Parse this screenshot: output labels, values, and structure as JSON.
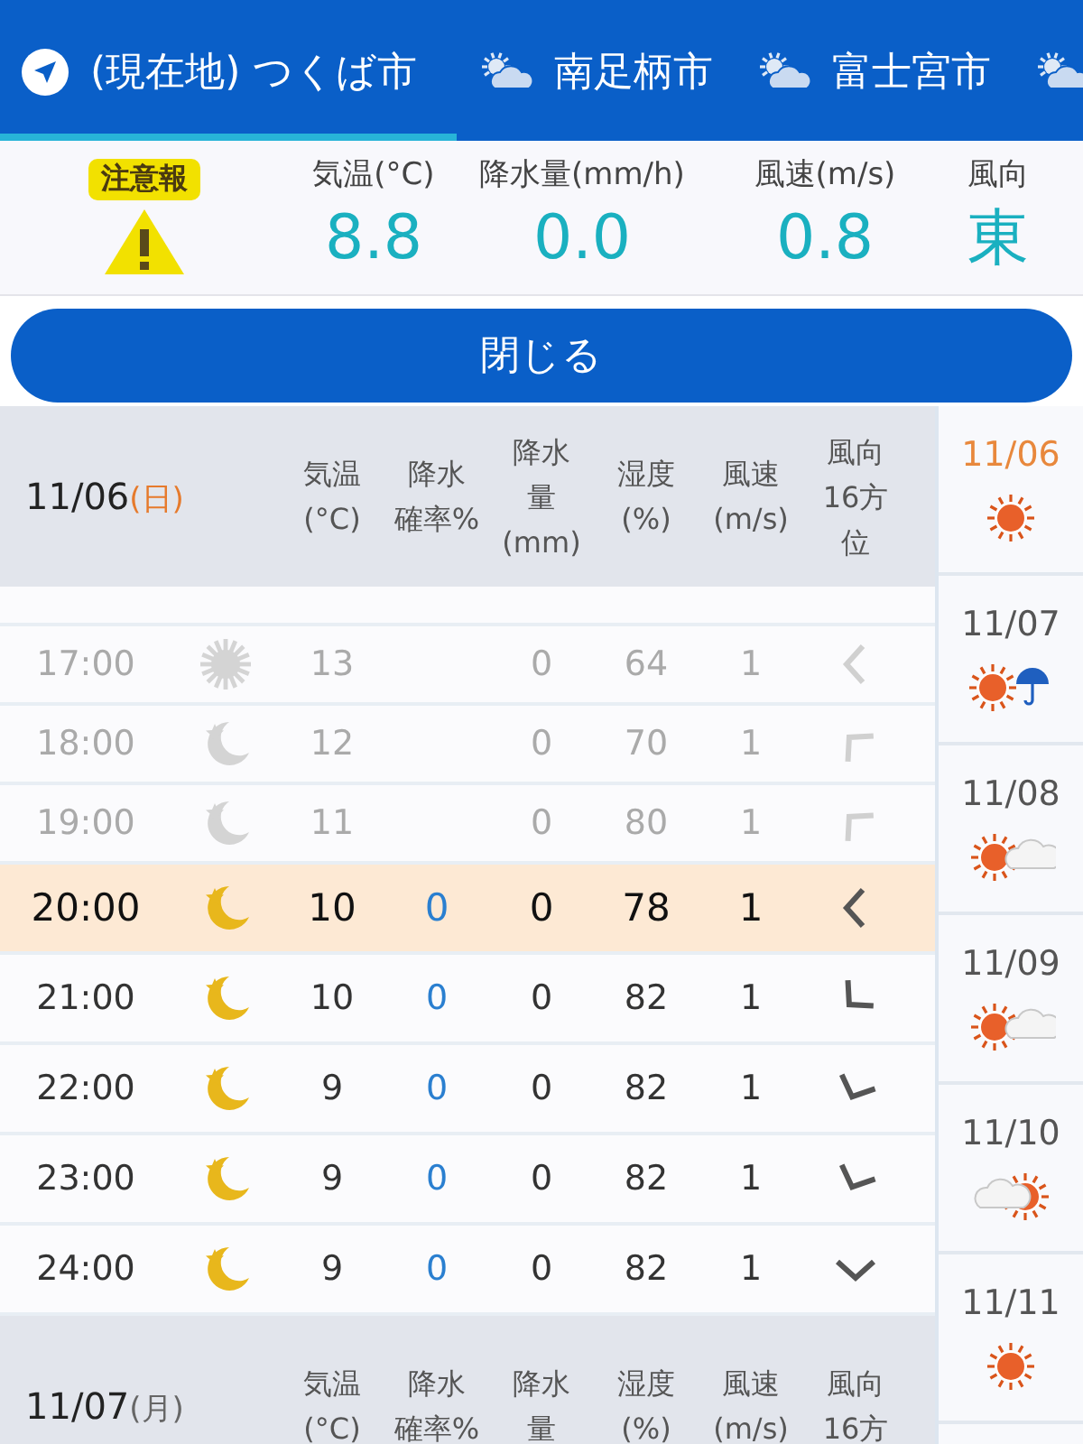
{
  "tabs": [
    {
      "label": "(現在地) つくば市",
      "kind": "location",
      "selected": true
    },
    {
      "label": "南足柄市",
      "kind": "weather",
      "selected": false
    },
    {
      "label": "富士宮市",
      "kind": "weather",
      "selected": false
    },
    {
      "kind": "weather",
      "selected": false
    }
  ],
  "current": {
    "warning": {
      "badge": "注意報"
    },
    "readings": [
      {
        "label": "気温(°C)",
        "value": "8.8"
      },
      {
        "label": "降水量(mm/h)",
        "value": "0.0"
      },
      {
        "label": "風速(m/s)",
        "value": "0.8"
      },
      {
        "label": "風向",
        "value": "東"
      }
    ]
  },
  "close_button": "閉じる",
  "days": [
    {
      "date": "11/06",
      "weekday": "(日)",
      "sunday": true,
      "columns": [
        [
          "気温",
          "(°C)"
        ],
        [
          "降水",
          "確率%"
        ],
        [
          "降水",
          "量",
          "(mm)"
        ],
        [
          "湿度",
          "(%)"
        ],
        [
          "風速",
          "(m/s)"
        ],
        [
          "風向",
          "16方",
          "位"
        ]
      ],
      "rows": [
        {
          "time": "17:00",
          "kind": "sun",
          "temp": "13",
          "rain": "0",
          "humidity": "64",
          "wind": "1",
          "direction": {
            "kind": "e"
          },
          "past": true,
          "selected": false
        },
        {
          "time": "18:00",
          "kind": "moon",
          "temp": "12",
          "rain": "0",
          "humidity": "70",
          "wind": "1",
          "direction": {
            "kind": "ne"
          },
          "past": true,
          "selected": false
        },
        {
          "time": "19:00",
          "kind": "moon",
          "temp": "11",
          "rain": "0",
          "humidity": "80",
          "wind": "1",
          "direction": {
            "kind": "ne"
          },
          "past": true,
          "selected": false
        },
        {
          "time": "20:00",
          "kind": "moon",
          "temp": "10",
          "prob": "0",
          "rain": "0",
          "humidity": "78",
          "wind": "1",
          "direction": {
            "kind": "e"
          },
          "past": false,
          "selected": true
        },
        {
          "time": "21:00",
          "kind": "moon",
          "temp": "10",
          "prob": "0",
          "rain": "0",
          "humidity": "82",
          "wind": "1",
          "direction": {
            "kind": "se"
          },
          "past": false,
          "selected": false
        },
        {
          "time": "22:00",
          "kind": "moon",
          "temp": "9",
          "prob": "0",
          "rain": "0",
          "humidity": "82",
          "wind": "1",
          "direction": {
            "kind": "sse"
          },
          "past": false,
          "selected": false
        },
        {
          "time": "23:00",
          "kind": "moon",
          "temp": "9",
          "prob": "0",
          "rain": "0",
          "humidity": "82",
          "wind": "1",
          "direction": {
            "kind": "sse"
          },
          "past": false,
          "selected": false
        },
        {
          "time": "24:00",
          "kind": "moon",
          "temp": "9",
          "prob": "0",
          "rain": "0",
          "humidity": "82",
          "wind": "1",
          "direction": {
            "kind": "s"
          },
          "past": false,
          "selected": false
        }
      ]
    },
    {
      "date": "11/07",
      "weekday": "(月)",
      "sunday": false,
      "columns": [
        [
          "気温",
          "(°C)"
        ],
        [
          "降水",
          "確率%"
        ],
        [
          "降水",
          "量"
        ],
        [
          "湿度",
          "(%)"
        ],
        [
          "風速",
          "(m/s)"
        ],
        [
          "風向",
          "16方"
        ]
      ]
    }
  ],
  "daily": [
    {
      "date": "11/06",
      "kind": "sunny",
      "selected": true
    },
    {
      "date": "11/07",
      "kind": "sunny_rain",
      "selected": false
    },
    {
      "date": "11/08",
      "kind": "sunny_cloudy",
      "selected": false
    },
    {
      "date": "11/09",
      "kind": "sunny_cloudy",
      "selected": false
    },
    {
      "date": "11/10",
      "kind": "cloudy_sunny",
      "selected": false
    },
    {
      "date": "11/11",
      "kind": "sunny",
      "selected": false
    }
  ]
}
